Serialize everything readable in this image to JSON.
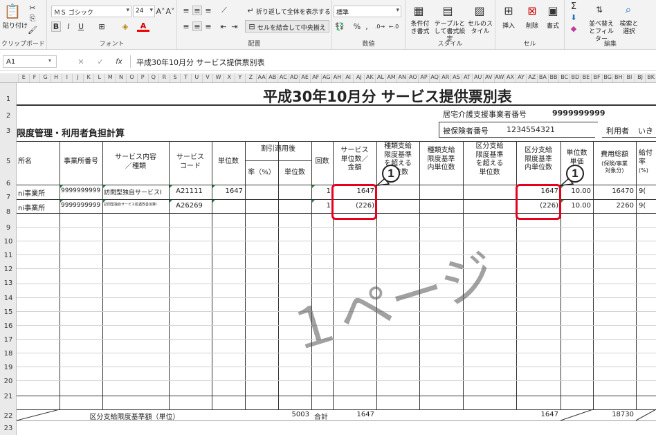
{
  "ribbon": {
    "clipboard": {
      "paste": "貼り付け",
      "label": "クリップボード"
    },
    "font": {
      "name": "ＭＳ ゴシック",
      "size": "24",
      "label": "フォント",
      "bold": "B",
      "italic": "I",
      "underline": "U"
    },
    "alignment": {
      "wrap": "折り返して全体を表示する",
      "merge": "セルを結合して中央揃え",
      "label": "配置"
    },
    "number": {
      "format": "標準",
      "label": "数値",
      "percent": "%",
      "comma": ","
    },
    "styles": {
      "conditional": "条件付き書式",
      "table": "テーブルとして書式設定",
      "cell": "セルのスタイル",
      "label": "スタイル"
    },
    "cells": {
      "insert": "挿入",
      "delete": "削除",
      "format": "書式",
      "label": "セル"
    },
    "editing": {
      "sort": "並べ替えとフィルター",
      "find": "検索と選択",
      "label": "編集"
    }
  },
  "formula_bar": {
    "name_box": "A1",
    "fx": "fx",
    "content": "平成30年10月分 サービス提供票別表"
  },
  "column_letters": [
    "E",
    "F",
    "G",
    "H",
    "I",
    "J",
    "K",
    "L",
    "M",
    "N",
    "O",
    "P",
    "Q",
    "R",
    "S",
    "T",
    "U",
    "V",
    "W",
    "X",
    "Y",
    "Z",
    "AA",
    "AB",
    "AC",
    "AD",
    "AE",
    "AF",
    "AG",
    "AH",
    "AI",
    "AJ",
    "AK",
    "AL",
    "AM",
    "AN",
    "AO",
    "AP",
    "AQ",
    "AR",
    "AS",
    "AT",
    "AU",
    "AV",
    "AW",
    "AX",
    "AY",
    "AZ",
    "BA",
    "BB",
    "BC",
    "BD",
    "BE",
    "BF",
    "BG",
    "BH",
    "BI",
    "BJ",
    "BK"
  ],
  "row_numbers": [
    "1",
    "2",
    "3",
    "5",
    "6",
    "7",
    "8",
    "9",
    "10",
    "11",
    "12",
    "13",
    "14",
    "15",
    "16",
    "17",
    "18",
    "19",
    "20",
    "21",
    "22",
    "23"
  ],
  "sheet": {
    "title": "平成30年10月分  サービス提供票別表",
    "provider_label": "居宅介護支援事業者番号",
    "provider_number": "9999999999",
    "insured_label": "被保険者番号",
    "insured_number": "1234554321",
    "user_label": "利用者",
    "user_name": "いき",
    "section_title": "限度管理・利用者負担計算",
    "headers": {
      "office_name": "所名",
      "office_number": "事業所番号",
      "service_content": "サービス内容\n／種類",
      "service_code": "サービス\nコード",
      "unit_count": "単位数",
      "discount": "割引適用後",
      "rate": "率（%）",
      "disc_units": "単位数",
      "times": "回数",
      "service_units": "サービス\n単位数／\n金額",
      "type_over": "種類支給\n限度基準\nを超える\n単位数",
      "type_within": "種類支給\n限度基準\n内単位数",
      "cat_over": "区分支給\n限度基準\nを超える\n単位数",
      "cat_within": "区分支給\n限度基準\n内単位数",
      "unit_price": "単位数\n単価",
      "total_cost": "費用総額",
      "total_cost_sub": "(保険/事業\n対象分)",
      "benefit": "給付\n率",
      "benefit_sub": "(%)"
    },
    "rows": [
      {
        "office": "ni事業所",
        "number": "9999999999",
        "content": "訪問型独自サービスⅠ",
        "code": "A21111",
        "units": "1647",
        "times": "1",
        "service_units": "1647",
        "cat_within": "1647",
        "price": "10.00",
        "cost": "16470",
        "benefit": "9("
      },
      {
        "office": "ni事業所",
        "number": "9999999999",
        "content": "訪問型独自サービス処遇改善加算Ⅰ",
        "code": "A26269",
        "units": "",
        "times": "1",
        "service_units": "(226)",
        "cat_within": "(226)",
        "price": "10.00",
        "cost": "2260",
        "benefit": "9("
      }
    ],
    "total_row": {
      "label": "区分支給限度基準額（単位）",
      "limit": "5003",
      "sum_label": "合計",
      "service_units": "1647",
      "cat_within": "1647",
      "cost": "18730"
    },
    "watermark": "１ページ",
    "badge": "1"
  }
}
